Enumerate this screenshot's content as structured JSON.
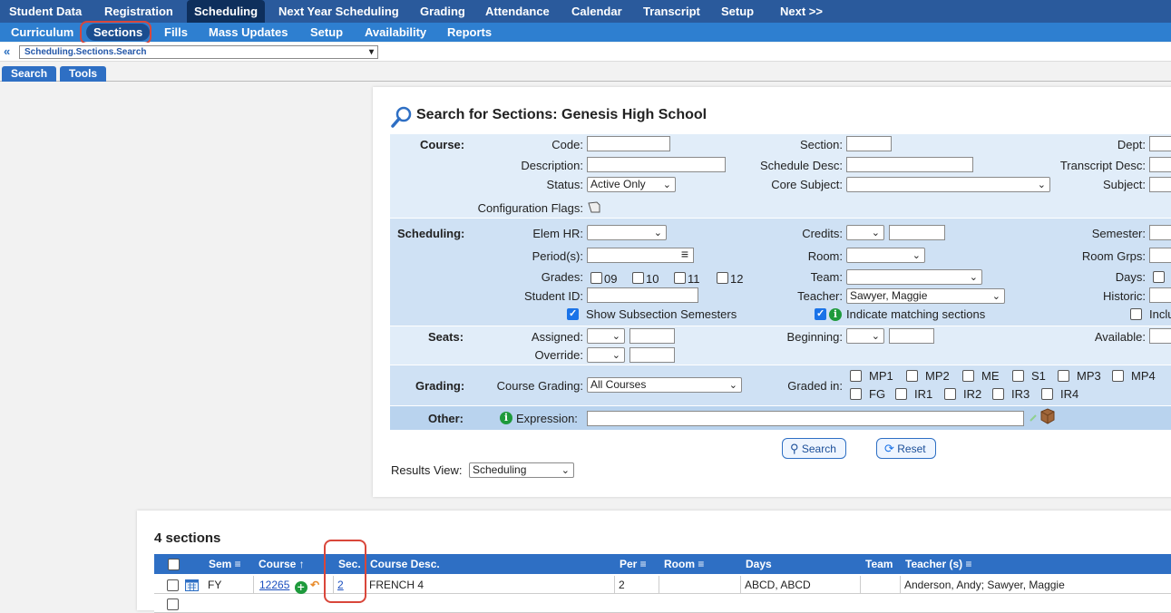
{
  "topnav": [
    "Student Data",
    "Registration",
    "Scheduling",
    "Next Year Scheduling",
    "Grading",
    "Attendance",
    "Calendar",
    "Transcript",
    "Setup",
    "Next >>"
  ],
  "subnav": [
    "Curriculum",
    "Sections",
    "Fills",
    "Mass Updates",
    "Setup",
    "Availability",
    "Reports"
  ],
  "path": {
    "back": "«",
    "value": "Scheduling.Sections.Search"
  },
  "tabs": [
    "Search",
    "Tools"
  ],
  "search": {
    "title": "Search for Sections: Genesis High School",
    "course_label": "Course:",
    "code_label": "Code:",
    "description_label": "Description:",
    "status_label": "Status:",
    "status_value": "Active Only",
    "config_flags_label": "Configuration Flags:",
    "section_label": "Section:",
    "schedule_desc_label": "Schedule Desc:",
    "core_subject_label": "Core Subject:",
    "dept_label": "Dept:",
    "transcript_desc_label": "Transcript Desc:",
    "subject_label": "Subject:",
    "scheduling_label": "Scheduling:",
    "elem_hr_label": "Elem HR:",
    "periods_label": "Period(s):",
    "grades_label": "Grades:",
    "grades": [
      "09",
      "10",
      "11",
      "12"
    ],
    "student_id_label": "Student ID:",
    "show_subsection_label": "Show Subsection Semesters",
    "credits_label": "Credits:",
    "room_label": "Room:",
    "team_label": "Team:",
    "teacher_label": "Teacher:",
    "teacher_value": "Sawyer, Maggie",
    "indicate_label": "Indicate matching sections",
    "semester_label": "Semester:",
    "room_grps_label": "Room Grps:",
    "days_label": "Days:",
    "historic_label": "Historic:",
    "incl_label": "Inclu",
    "seats_label": "Seats:",
    "assigned_label": "Assigned:",
    "override_label": "Override:",
    "beginning_label": "Beginning:",
    "available_label": "Available:",
    "grading_label": "Grading:",
    "course_grading_label": "Course Grading:",
    "course_grading_value": "All Courses",
    "graded_in_label": "Graded in:",
    "graded_in_row1": [
      "MP1",
      "MP2",
      "ME",
      "S1",
      "MP3",
      "MP4"
    ],
    "graded_in_row2": [
      "FG",
      "IR1",
      "IR2",
      "IR3",
      "IR4"
    ],
    "other_label": "Other:",
    "expression_label": "Expression:",
    "search_button": "Search",
    "reset_button": "Reset",
    "results_view_label": "Results View:",
    "results_view_value": "Scheduling"
  },
  "results": {
    "count": "4 sections",
    "headers": [
      "Sem ≡",
      "Course ↑",
      "Sec.",
      "Course Desc.",
      "Per ≡",
      "Room ≡",
      "Days",
      "Team",
      "Teacher (s) ≡"
    ],
    "rows": [
      {
        "sem": "FY",
        "course": "12265",
        "sec": "2",
        "desc": "FRENCH 4",
        "per": "2",
        "room": "",
        "days": "ABCD, ABCD",
        "team": "",
        "teacher": "Anderson, Andy; Sawyer, Maggie"
      }
    ]
  },
  "colors": {
    "topnav": "#2a5a9c",
    "subnav": "#2e7fd0",
    "highlight": "#d9463a"
  }
}
